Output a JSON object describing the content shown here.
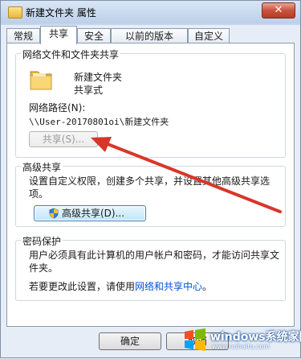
{
  "window": {
    "title": "新建文件夹 属性",
    "close_label": "✕"
  },
  "tabs": [
    {
      "label": "常规",
      "active": false
    },
    {
      "label": "共享",
      "active": true
    },
    {
      "label": "安全",
      "active": false
    },
    {
      "label": "以前的版本",
      "active": false
    },
    {
      "label": "自定义",
      "active": false
    }
  ],
  "network_sharing": {
    "group_title": "网络文件和文件夹共享",
    "folder_name": "新建文件夹",
    "share_status": "共享式",
    "path_label": "网络路径(N):",
    "path_value": "\\\\User-20170801oi\\新建文件夹",
    "share_button": "共享(S)...",
    "share_button_enabled": false
  },
  "advanced_sharing": {
    "group_title": "高级共享",
    "description": "设置自定义权限，创建多个共享，并设置其他高级共享选项。",
    "button_label": "高级共享(D)..."
  },
  "password_protection": {
    "group_title": "密码保护",
    "description": "用户必须具有此计算机的用户帐户和密码，才能访问共享文件夹。",
    "change_prefix": "若要更改此设置，请使用",
    "link_text": "网络和共享中心",
    "change_suffix": "。"
  },
  "footer": {
    "ok_label": "确定",
    "cancel_label": "取消"
  },
  "watermark": {
    "line1": "windows系统家园",
    "line2": "www.ruihaitu.com"
  },
  "colors": {
    "annotation_arrow": "#d9362a",
    "link": "#0055d4"
  }
}
